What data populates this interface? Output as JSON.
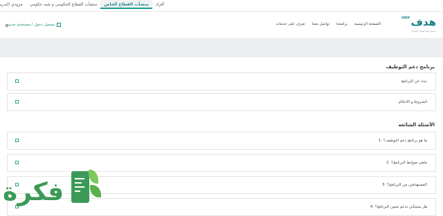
{
  "top_tabs": [
    {
      "label": "أفراد",
      "active": false
    },
    {
      "label": "منشآت القطاع الخاص",
      "active": true
    },
    {
      "label": "منشآت القطاع الحكومي و شبه حكومي",
      "active": false
    },
    {
      "label": "مزودي التدريب",
      "active": false
    }
  ],
  "logo": {
    "arabic": "هدف",
    "english": "HRDF",
    "subtitle": "صندوق تنمية الموارد البشرية"
  },
  "main_nav": [
    {
      "label": "الصفحة الرئيسية"
    },
    {
      "label": "برامجنا"
    },
    {
      "label": "تواصل معنا"
    },
    {
      "label": "تعرف على خدمات"
    }
  ],
  "login_label": "تسجيل دخول / مستخدم جديد",
  "program_section": {
    "title": "برنامج دعم التوظيف",
    "items": [
      {
        "label": "نبذه عن البرنامج"
      },
      {
        "label": "الشروط و الاحكام"
      }
    ]
  },
  "faq_section": {
    "title": "الأسئلة الشائعة",
    "items": [
      {
        "label": "1. ما هو برنامج دعم التوظيف؟"
      },
      {
        "label": "2. ماهي ضوابط البرنامج؟"
      },
      {
        "label": "3. المستهدفين من البرنامج؟"
      },
      {
        "label": "4. هل منشآتي تدعم ضمن البرنامج؟"
      }
    ]
  },
  "watermark": {
    "text": "فكرة"
  },
  "colors": {
    "accent": "#1c9a8f",
    "brand_green": "#3c9a58",
    "band": "#eceef0"
  }
}
